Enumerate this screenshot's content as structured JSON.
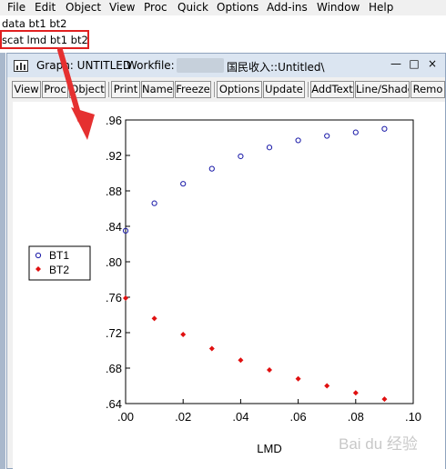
{
  "menu": [
    "File",
    "Edit",
    "Object",
    "View",
    "Proc",
    "Quick",
    "Options",
    "Add-ins",
    "Window",
    "Help"
  ],
  "command_window": {
    "line1": "data bt1 bt2",
    "line2": "scat lmd bt1 bt2"
  },
  "graph_window": {
    "title": "Graph: UNTITLED",
    "workfile_label": "Workfile:",
    "workfile_name": "国民收入::Untitled\\",
    "minimize": "—",
    "restore": "□",
    "close": "×"
  },
  "toolbar": [
    "View",
    "Proc",
    "Object",
    "Print",
    "Name",
    "Freeze",
    "Options",
    "Update",
    "AddText",
    "Line/Shade",
    "Remo"
  ],
  "watermark": "Bai du 经验",
  "colors": {
    "bt1": "#1a1aa8",
    "bt2": "#e01010",
    "highlight": "#e02020"
  },
  "chart_data": {
    "type": "scatter",
    "xlabel": "LMD",
    "ylabel": "",
    "xlim": [
      0.0,
      0.1
    ],
    "ylim": [
      0.64,
      0.96
    ],
    "x_ticks": [
      ".00",
      ".02",
      ".04",
      ".06",
      ".08",
      ".10"
    ],
    "y_ticks": [
      ".96",
      ".92",
      ".88",
      ".84",
      ".80",
      ".76",
      ".72",
      ".68",
      ".64"
    ],
    "x": [
      0.0,
      0.01,
      0.02,
      0.03,
      0.04,
      0.05,
      0.06,
      0.07,
      0.08,
      0.09
    ],
    "series": [
      {
        "name": "BT1",
        "marker": "open-circle",
        "values": [
          0.835,
          0.866,
          0.888,
          0.905,
          0.919,
          0.929,
          0.937,
          0.942,
          0.946,
          0.95
        ]
      },
      {
        "name": "BT2",
        "marker": "filled-diamond",
        "values": [
          0.759,
          0.736,
          0.718,
          0.702,
          0.689,
          0.678,
          0.668,
          0.66,
          0.652,
          0.645
        ]
      }
    ],
    "legend_position": "left",
    "grid": false
  }
}
